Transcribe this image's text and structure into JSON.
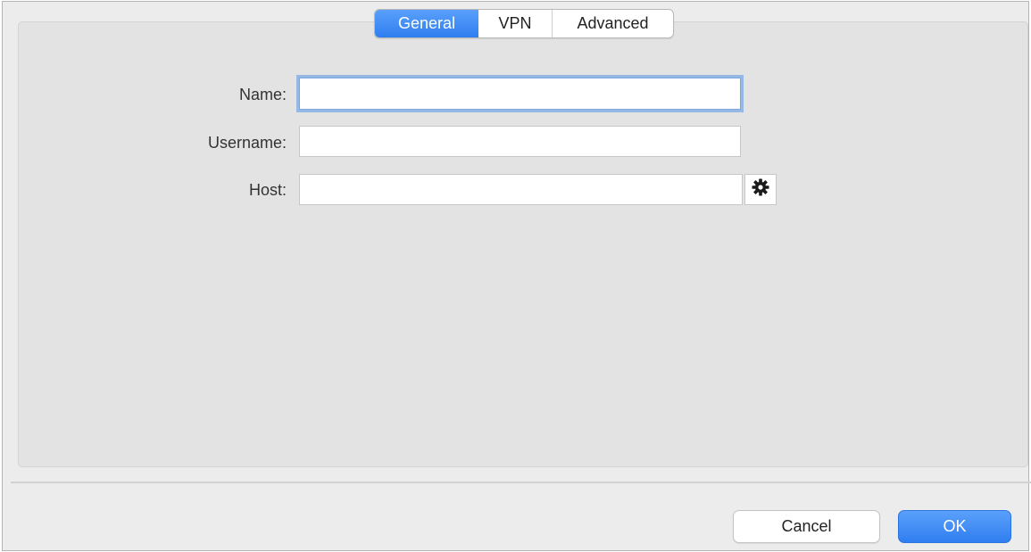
{
  "tabs": [
    {
      "label": "General",
      "selected": true
    },
    {
      "label": "VPN",
      "selected": false
    },
    {
      "label": "Advanced",
      "selected": false
    }
  ],
  "form": {
    "name_label": "Name:",
    "name_value": "",
    "username_label": "Username:",
    "username_value": "",
    "host_label": "Host:",
    "host_value": "",
    "host_options_icon": "gear-icon"
  },
  "footer": {
    "cancel_label": "Cancel",
    "ok_label": "OK"
  },
  "colors": {
    "accent": "#3a86f4",
    "focus_ring": "#5696eb",
    "panel_background": "#e3e3e3",
    "window_background": "#ececec"
  }
}
